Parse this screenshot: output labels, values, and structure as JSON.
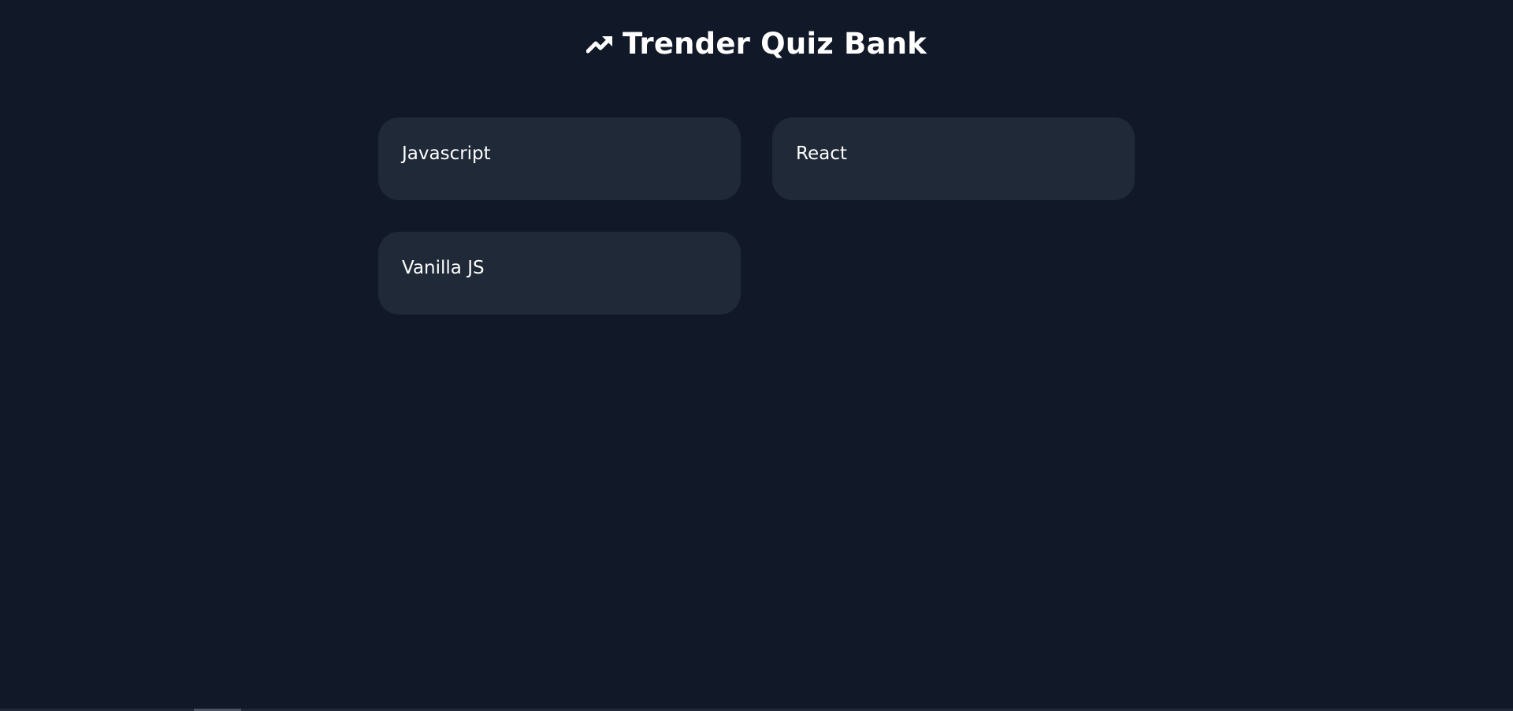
{
  "header": {
    "title": "Trender Quiz Bank",
    "icon": "trending-up-icon"
  },
  "quizzes": [
    {
      "label": "Javascript"
    },
    {
      "label": "React"
    },
    {
      "label": "Vanilla JS"
    }
  ],
  "colors": {
    "background": "#111827",
    "card": "#1f2937",
    "text": "#ffffff"
  }
}
